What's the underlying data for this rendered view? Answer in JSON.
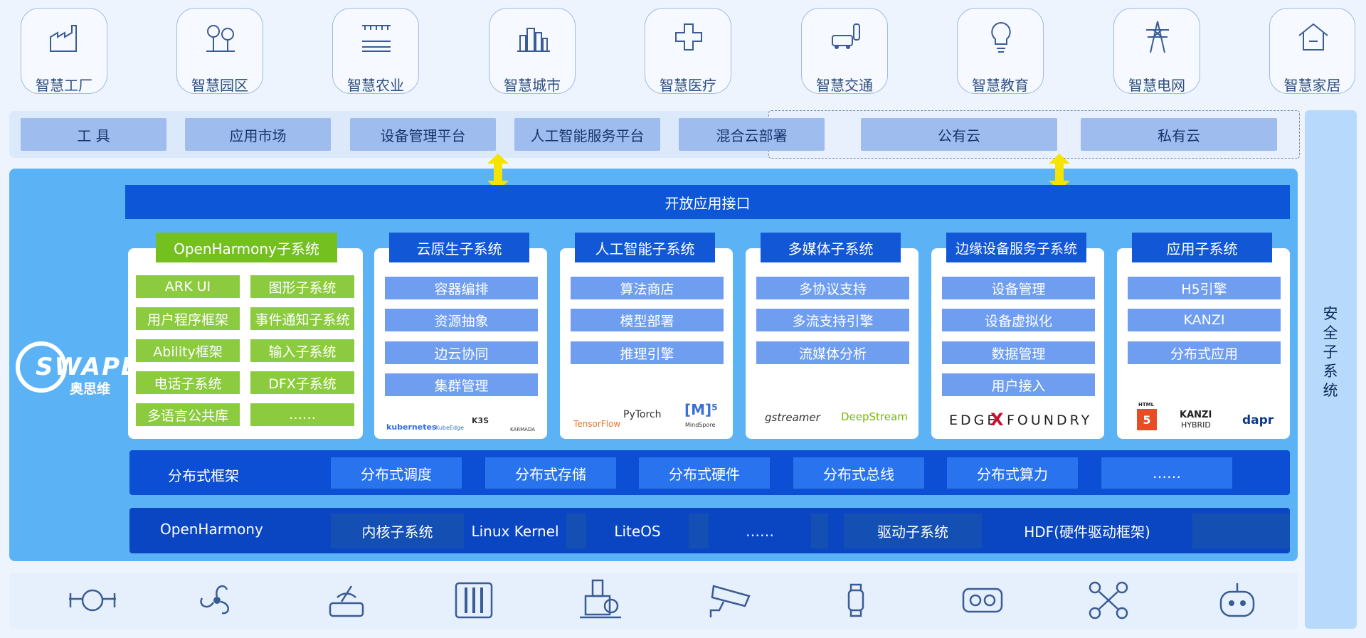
{
  "scenes": [
    "智慧工厂",
    "智慧园区",
    "智慧农业",
    "智慧城市",
    "智慧医疗",
    "智慧交通",
    "智慧教育",
    "智慧电网",
    "智慧家居"
  ],
  "platform": {
    "items": [
      "工 具",
      "应用市场",
      "设备管理平台",
      "人工智能服务平台",
      "混合云部署"
    ],
    "cloud": [
      "公有云",
      "私有云"
    ]
  },
  "api_label": "开放应用接口",
  "brand": {
    "logo_text": "SWAPE",
    "name": "奥思维"
  },
  "security": "安全子系统",
  "openharmony_sub": {
    "title": "OpenHarmony子系统",
    "cells": [
      "ARK UI",
      "图形子系统",
      "用户程序框架",
      "事件通知子系统",
      "Ability框架",
      "输入子系统",
      "电话子系统",
      "DFX子系统",
      "多语言公共库",
      "……"
    ]
  },
  "subsystems": [
    {
      "title": "云原生子系统",
      "cells": [
        "容器编排",
        "资源抽象",
        "边云协同",
        "集群管理"
      ],
      "logos": [
        "kubernetes",
        "KubeEdge",
        "K3S",
        "KARMADA"
      ]
    },
    {
      "title": "人工智能子系统",
      "cells": [
        "算法商店",
        "模型部署",
        "推理引擎"
      ],
      "logos": [
        "TensorFlow",
        "PyTorch",
        "[M]⁵",
        "MindSpore"
      ]
    },
    {
      "title": "多媒体子系统",
      "cells": [
        "多协议支持",
        "多流支持引擎",
        "流媒体分析"
      ],
      "logos": [
        "gstreamer",
        "DeepStream"
      ]
    },
    {
      "title": "边缘设备服务子系统",
      "cells": [
        "设备管理",
        "设备虚拟化",
        "数据管理",
        "用户接入"
      ],
      "logos": [
        "EDGE",
        "FOUNDRY"
      ]
    },
    {
      "title": "应用子系统",
      "cells": [
        "H5引擎",
        "KANZI",
        "分布式应用"
      ],
      "logos": [
        "HTML",
        "5",
        "KANZI",
        "HYBRID",
        "dapr"
      ]
    }
  ],
  "distributed": {
    "label": "分布式框架",
    "cells": [
      "分布式调度",
      "分布式存储",
      "分布式硬件",
      "分布式总线",
      "分布式算力",
      "……"
    ]
  },
  "openharmony": {
    "label": "OpenHarmony",
    "cells": [
      "内核子系统",
      "Linux Kernel",
      "LiteOS",
      "……",
      "驱动子系统",
      "HDF(硬件驱动框架)"
    ]
  },
  "colors": {
    "accent": "#0d56d8",
    "green": "#8ccb3f",
    "arrow": "#f5e400"
  }
}
